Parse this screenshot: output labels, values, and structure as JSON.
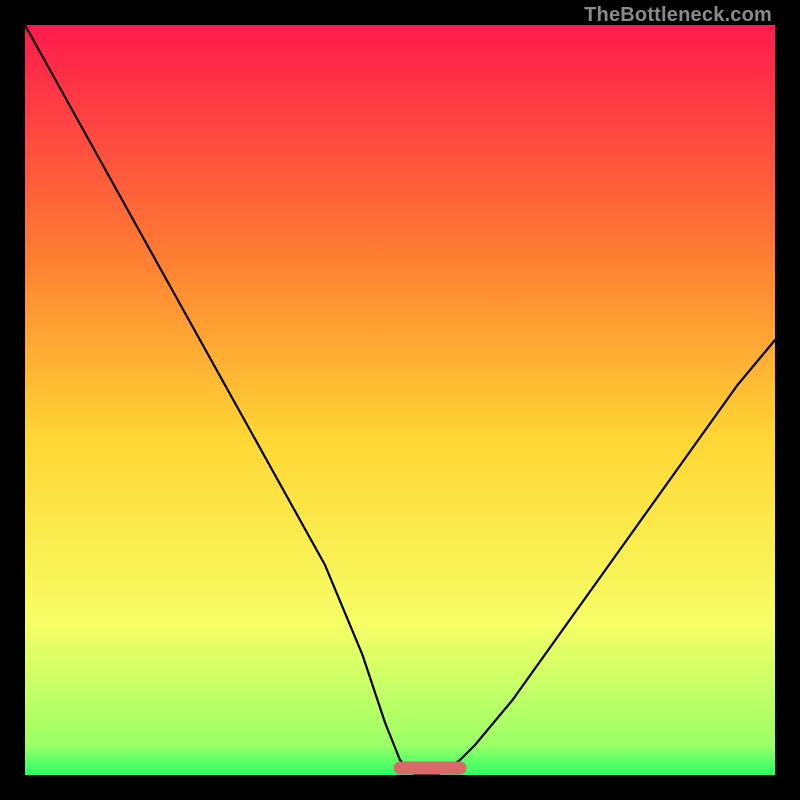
{
  "watermark": "TheBottleneck.com",
  "colors": {
    "bg": "#000000",
    "grad_top": "#ff1a4d",
    "grad_upper_mid": "#ff7a33",
    "grad_mid": "#ffd633",
    "grad_lower_mid": "#f6ff66",
    "grad_bottom": "#2bff66",
    "curve": "#000000",
    "flat_marker": "#d86a6a"
  },
  "chart_data": {
    "type": "line",
    "title": "",
    "xlabel": "",
    "ylabel": "",
    "xlim": [
      0,
      100
    ],
    "ylim": [
      0,
      100
    ],
    "series": [
      {
        "name": "bottleneck-curve",
        "x": [
          0,
          5,
          10,
          15,
          20,
          25,
          30,
          35,
          40,
          45,
          48,
          50,
          52,
          55,
          58,
          60,
          65,
          70,
          75,
          80,
          85,
          90,
          95,
          100
        ],
        "values": [
          100,
          91,
          82,
          73,
          64,
          55,
          46,
          37,
          28,
          16,
          7,
          2,
          0,
          0,
          2,
          4,
          10,
          17,
          24,
          31,
          38,
          45,
          52,
          58
        ]
      }
    ],
    "flat_region": {
      "x_start": 50,
      "x_end": 58,
      "y": 0
    },
    "annotations": [
      {
        "text": "TheBottleneck.com",
        "position": "top-right"
      }
    ]
  }
}
